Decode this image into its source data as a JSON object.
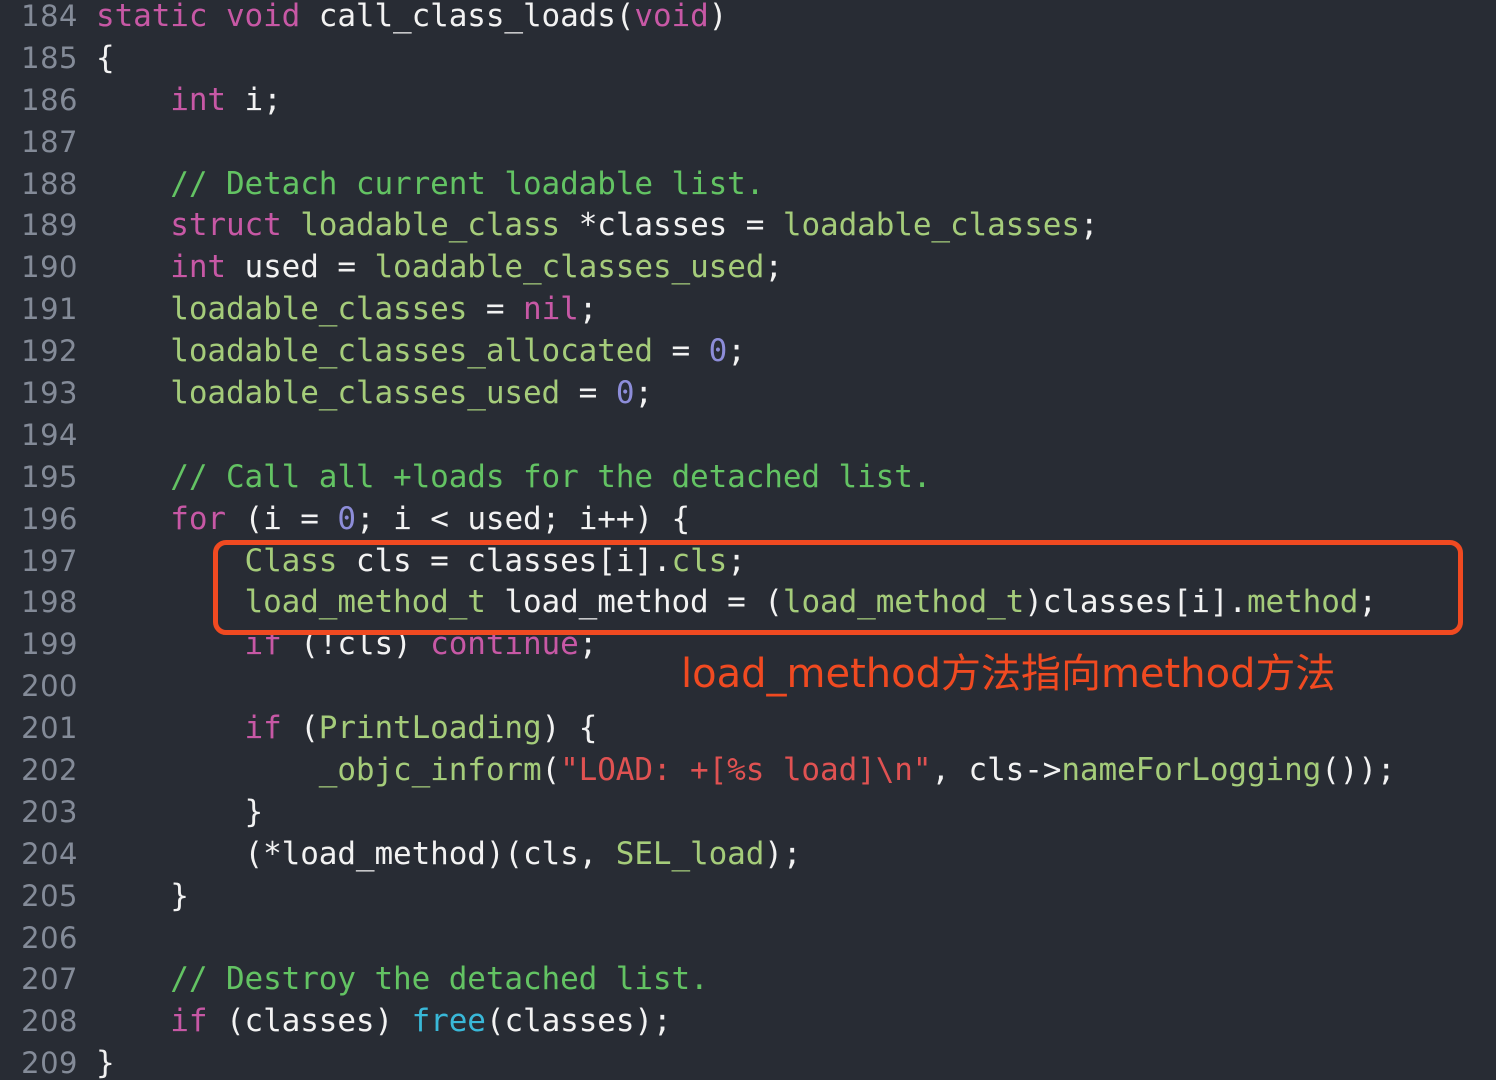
{
  "editor": {
    "background_color": "#282c34",
    "gutter_color": "#848b98",
    "default_text_color": "#f2f2f2",
    "language": "objective-c",
    "first_line_number": 184
  },
  "palette": {
    "keyword": "#c758a5",
    "identifier": "#a5cc7a",
    "plain": "#f2f2f2",
    "number": "#8d8dd9",
    "comment": "#63c363",
    "string": "#e05252",
    "function": "#39b8d8",
    "annotation": "#f04a21"
  },
  "annotation": {
    "box": {
      "label": "highlight-rectangle",
      "color": "#f04a21",
      "covers_lines": "197-198"
    },
    "note": "load_method方法指向method方法"
  },
  "lines": [
    {
      "number": "184",
      "text": "static void call_class_loads(void)",
      "tokens": [
        {
          "t": "static ",
          "c": "key"
        },
        {
          "t": "void ",
          "c": "key"
        },
        {
          "t": "call_class_loads(",
          "c": "plain"
        },
        {
          "t": "void",
          "c": "key"
        },
        {
          "t": ")",
          "c": "plain"
        }
      ]
    },
    {
      "number": "185",
      "text": "{",
      "tokens": [
        {
          "t": "{",
          "c": "plain"
        }
      ]
    },
    {
      "number": "186",
      "text": "    int i;",
      "tokens": [
        {
          "t": "    ",
          "c": "plain"
        },
        {
          "t": "int",
          "c": "key"
        },
        {
          "t": " i;",
          "c": "plain"
        }
      ]
    },
    {
      "number": "187",
      "text": "",
      "tokens": []
    },
    {
      "number": "188",
      "text": "    // Detach current loadable list.",
      "tokens": [
        {
          "t": "    ",
          "c": "plain"
        },
        {
          "t": "// Detach current loadable list.",
          "c": "cmt"
        }
      ]
    },
    {
      "number": "189",
      "text": "    struct loadable_class *classes = loadable_classes;",
      "tokens": [
        {
          "t": "    ",
          "c": "plain"
        },
        {
          "t": "struct",
          "c": "key"
        },
        {
          "t": " ",
          "c": "plain"
        },
        {
          "t": "loadable_class",
          "c": "ident"
        },
        {
          "t": " *classes = ",
          "c": "plain"
        },
        {
          "t": "loadable_classes",
          "c": "ident"
        },
        {
          "t": ";",
          "c": "plain"
        }
      ]
    },
    {
      "number": "190",
      "text": "    int used = loadable_classes_used;",
      "tokens": [
        {
          "t": "    ",
          "c": "plain"
        },
        {
          "t": "int",
          "c": "key"
        },
        {
          "t": " used = ",
          "c": "plain"
        },
        {
          "t": "loadable_classes_used",
          "c": "ident"
        },
        {
          "t": ";",
          "c": "plain"
        }
      ]
    },
    {
      "number": "191",
      "text": "    loadable_classes = nil;",
      "tokens": [
        {
          "t": "    ",
          "c": "plain"
        },
        {
          "t": "loadable_classes",
          "c": "ident"
        },
        {
          "t": " = ",
          "c": "plain"
        },
        {
          "t": "nil",
          "c": "key"
        },
        {
          "t": ";",
          "c": "plain"
        }
      ]
    },
    {
      "number": "192",
      "text": "    loadable_classes_allocated = 0;",
      "tokens": [
        {
          "t": "    ",
          "c": "plain"
        },
        {
          "t": "loadable_classes_allocated",
          "c": "ident"
        },
        {
          "t": " = ",
          "c": "plain"
        },
        {
          "t": "0",
          "c": "num"
        },
        {
          "t": ";",
          "c": "plain"
        }
      ]
    },
    {
      "number": "193",
      "text": "    loadable_classes_used = 0;",
      "tokens": [
        {
          "t": "    ",
          "c": "plain"
        },
        {
          "t": "loadable_classes_used",
          "c": "ident"
        },
        {
          "t": " = ",
          "c": "plain"
        },
        {
          "t": "0",
          "c": "num"
        },
        {
          "t": ";",
          "c": "plain"
        }
      ]
    },
    {
      "number": "194",
      "text": "",
      "tokens": []
    },
    {
      "number": "195",
      "text": "    // Call all +loads for the detached list.",
      "tokens": [
        {
          "t": "    ",
          "c": "plain"
        },
        {
          "t": "// Call all +loads for the detached list.",
          "c": "cmt"
        }
      ]
    },
    {
      "number": "196",
      "text": "    for (i = 0; i < used; i++) {",
      "tokens": [
        {
          "t": "    ",
          "c": "plain"
        },
        {
          "t": "for",
          "c": "key"
        },
        {
          "t": " (i = ",
          "c": "plain"
        },
        {
          "t": "0",
          "c": "num"
        },
        {
          "t": "; i < used; i++) {",
          "c": "plain"
        }
      ]
    },
    {
      "number": "197",
      "text": "        Class cls = classes[i].cls;",
      "tokens": [
        {
          "t": "        ",
          "c": "plain"
        },
        {
          "t": "Class",
          "c": "ident"
        },
        {
          "t": " cls = classes[i].",
          "c": "plain"
        },
        {
          "t": "cls",
          "c": "ident"
        },
        {
          "t": ";",
          "c": "plain"
        }
      ]
    },
    {
      "number": "198",
      "text": "        load_method_t load_method = (load_method_t)classes[i].method;",
      "tokens": [
        {
          "t": "        ",
          "c": "plain"
        },
        {
          "t": "load_method_t",
          "c": "ident"
        },
        {
          "t": " load_method = (",
          "c": "plain"
        },
        {
          "t": "load_method_t",
          "c": "ident"
        },
        {
          "t": ")classes[i].",
          "c": "plain"
        },
        {
          "t": "method",
          "c": "ident"
        },
        {
          "t": ";",
          "c": "plain"
        }
      ]
    },
    {
      "number": "199",
      "text": "        if (!cls) continue;",
      "tokens": [
        {
          "t": "        ",
          "c": "plain"
        },
        {
          "t": "if",
          "c": "key"
        },
        {
          "t": " (!cls) ",
          "c": "plain"
        },
        {
          "t": "continue",
          "c": "key"
        },
        {
          "t": ";",
          "c": "plain"
        }
      ]
    },
    {
      "number": "200",
      "text": "",
      "tokens": []
    },
    {
      "number": "201",
      "text": "        if (PrintLoading) {",
      "tokens": [
        {
          "t": "        ",
          "c": "plain"
        },
        {
          "t": "if",
          "c": "key"
        },
        {
          "t": " (",
          "c": "plain"
        },
        {
          "t": "PrintLoading",
          "c": "ident"
        },
        {
          "t": ") {",
          "c": "plain"
        }
      ]
    },
    {
      "number": "202",
      "text": "            _objc_inform(\"LOAD: +[%s load]\\n\", cls->nameForLogging());",
      "tokens": [
        {
          "t": "            ",
          "c": "plain"
        },
        {
          "t": "_objc_inform",
          "c": "ident"
        },
        {
          "t": "(",
          "c": "plain"
        },
        {
          "t": "\"LOAD: +[%s load]\\n\"",
          "c": "str"
        },
        {
          "t": ", cls->",
          "c": "plain"
        },
        {
          "t": "nameForLogging",
          "c": "ident"
        },
        {
          "t": "());",
          "c": "plain"
        }
      ]
    },
    {
      "number": "203",
      "text": "        }",
      "tokens": [
        {
          "t": "        }",
          "c": "plain"
        }
      ]
    },
    {
      "number": "204",
      "text": "        (*load_method)(cls, SEL_load);",
      "tokens": [
        {
          "t": "        (*load_method)(cls, ",
          "c": "plain"
        },
        {
          "t": "SEL_load",
          "c": "ident"
        },
        {
          "t": ");",
          "c": "plain"
        }
      ]
    },
    {
      "number": "205",
      "text": "    }",
      "tokens": [
        {
          "t": "    }",
          "c": "plain"
        }
      ]
    },
    {
      "number": "206",
      "text": "",
      "tokens": []
    },
    {
      "number": "207",
      "text": "    // Destroy the detached list.",
      "tokens": [
        {
          "t": "    ",
          "c": "plain"
        },
        {
          "t": "// Destroy the detached list.",
          "c": "cmt"
        }
      ]
    },
    {
      "number": "208",
      "text": "    if (classes) free(classes);",
      "tokens": [
        {
          "t": "    ",
          "c": "plain"
        },
        {
          "t": "if",
          "c": "key"
        },
        {
          "t": " (classes) ",
          "c": "plain"
        },
        {
          "t": "free",
          "c": "fn"
        },
        {
          "t": "(classes);",
          "c": "plain"
        }
      ]
    },
    {
      "number": "209",
      "text": "}",
      "tokens": [
        {
          "t": "}",
          "c": "plain"
        }
      ]
    }
  ]
}
